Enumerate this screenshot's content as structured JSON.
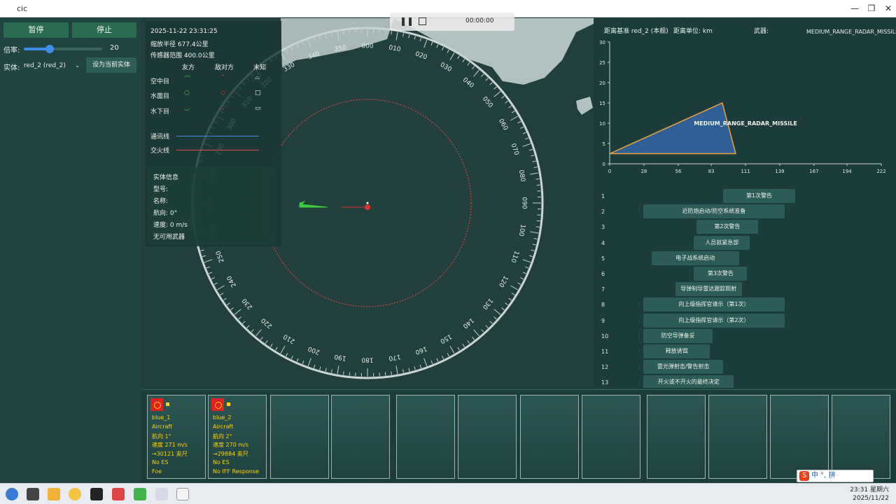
{
  "window": {
    "title": "cic",
    "min": "—",
    "max": "❐",
    "close": "✕"
  },
  "left": {
    "pause_label": "暂停",
    "stop_label": "停止",
    "rate_label": "倍率:",
    "rate_value": "20",
    "rate_fraction": 0.33,
    "entity_label": "实体:",
    "entity_value": "red_2 (red_2)",
    "set_current_label": "设为当前实体"
  },
  "info": {
    "datetime": "2025-11-22 23:31:25",
    "zoom_radius": "缩放半径 677.4公里",
    "sensor_range": "传感器范围 400.0公里",
    "col_friend": "友方",
    "col_enemy": "敌对方",
    "col_unknown": "未知",
    "row_air": "空中目",
    "row_surface": "水面目",
    "row_sub": "水下目",
    "comm_line": "通讯线",
    "fire_line": "交火线",
    "entity_info": "实体信息",
    "model": "型号:",
    "name": "名称:",
    "heading": "航向: 0°",
    "speed": "速度: 0 m/s",
    "no_weapon": "无可用武器"
  },
  "playback": {
    "time": "00:00:00",
    "play_icon": "pause-icon",
    "stop_icon": "stop-icon"
  },
  "compass": {
    "labels": [
      "000",
      "010",
      "020",
      "030",
      "040",
      "050",
      "060",
      "070",
      "080",
      "090",
      "100",
      "110",
      "120",
      "130",
      "140",
      "150",
      "160",
      "170",
      "180",
      "190",
      "200",
      "210",
      "220",
      "230",
      "240",
      "250",
      "260",
      "270",
      "280",
      "290",
      "300",
      "310",
      "320",
      "330",
      "340",
      "350"
    ]
  },
  "chart_header": {
    "base": "距离基准 red_2 (本舰)",
    "unit": "距离单位: km",
    "weapon": "武器:",
    "weapon_name": "MEDIUM_RANGE_RADAR_MISSILE"
  },
  "chart_data": {
    "type": "area",
    "title": "",
    "xlabel": "",
    "ylabel": "",
    "xlim": [
      0,
      222
    ],
    "ylim": [
      0,
      30
    ],
    "x_ticks": [
      "0",
      "28",
      "56",
      "83",
      "111",
      "139",
      "167",
      "194",
      "222"
    ],
    "y_ticks": [
      "0",
      "5",
      "10",
      "15",
      "20",
      "25",
      "30"
    ],
    "polygon": [
      [
        0,
        2.5
      ],
      [
        92,
        15
      ],
      [
        103,
        2.5
      ]
    ],
    "polygon_color": "#2f5f96",
    "outline_color": "#e8a23a",
    "label": "MEDIUM_RANGE_RADAR_MISSILE"
  },
  "timeline": {
    "rows": [
      "1",
      "2",
      "3",
      "4",
      "5",
      "6",
      "7",
      "8",
      "9",
      "10",
      "11",
      "12",
      "13"
    ],
    "items": [
      {
        "label": "第1次警告",
        "start": 0.39,
        "end": 0.66
      },
      {
        "label": "近防炮启动/防空系统准备",
        "start": 0.09,
        "end": 0.62
      },
      {
        "label": "第2次警告",
        "start": 0.29,
        "end": 0.52
      },
      {
        "label": "人员就紧急部",
        "start": 0.28,
        "end": 0.49
      },
      {
        "label": "电子战系统启动",
        "start": 0.12,
        "end": 0.45
      },
      {
        "label": "第3次警告",
        "start": 0.28,
        "end": 0.48
      },
      {
        "label": "导弹制导雷达跟踪照射",
        "start": 0.21,
        "end": 0.46
      },
      {
        "label": "向上级指挥官请示（第1次）",
        "start": 0.09,
        "end": 0.62
      },
      {
        "label": "向上级指挥官请示（第2次）",
        "start": 0.09,
        "end": 0.62
      },
      {
        "label": "防空导弹备妥",
        "start": 0.09,
        "end": 0.35
      },
      {
        "label": "释放诱饵",
        "start": 0.09,
        "end": 0.34
      },
      {
        "label": "雷光弹射击/警告射击",
        "start": 0.09,
        "end": 0.39
      },
      {
        "label": "开火或不开火的最终决定",
        "start": 0.09,
        "end": 0.43
      }
    ]
  },
  "cards": [
    {
      "name": "blue_1",
      "type": "Aircraft",
      "heading": "航向 1°",
      "speed": "速度 271 m/s",
      "alt": "→30121 英尺",
      "es": "No ES",
      "iff": "Foe"
    },
    {
      "name": "blue_2",
      "type": "Aircraft",
      "heading": "航向 2°",
      "speed": "速度 270 m/s",
      "alt": "→29884 英尺",
      "es": "No ES",
      "iff": "No IFF Response"
    }
  ],
  "ime": {
    "text": "中 °, 拼",
    "logo": "S"
  },
  "clock": {
    "time": "23:31 星期六",
    "date": "2025/11/22"
  },
  "colors": {
    "accent": "#2a6a4f",
    "slider": "#3f8de8",
    "enemy": "#e03030",
    "friend": "#3ccd3c",
    "sensor": "#e24a4a"
  }
}
